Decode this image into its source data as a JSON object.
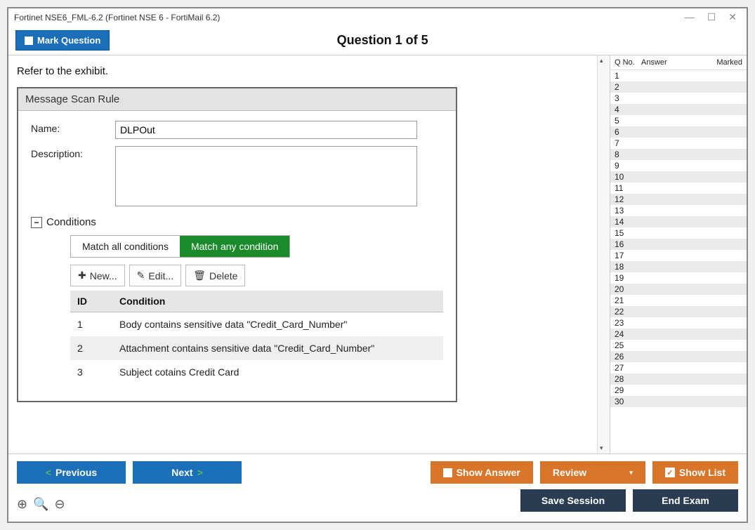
{
  "window": {
    "title": "Fortinet NSE6_FML-6.2 (Fortinet NSE 6 - FortiMail 6.2)"
  },
  "toolbar": {
    "mark_question": "Mark Question"
  },
  "question": {
    "title": "Question 1 of 5",
    "prompt": "Refer to the exhibit."
  },
  "exhibit": {
    "header": "Message Scan Rule",
    "name_label": "Name:",
    "name_value": "DLPOut",
    "description_label": "Description:",
    "description_value": "",
    "conditions_label": "Conditions",
    "match_all": "Match all conditions",
    "match_any": "Match any condition",
    "new_btn": "New...",
    "edit_btn": "Edit...",
    "delete_btn": "Delete",
    "col_id": "ID",
    "col_condition": "Condition",
    "rows": [
      {
        "id": "1",
        "text": "Body contains sensitive data \"Credit_Card_Number\""
      },
      {
        "id": "2",
        "text": "Attachment contains sensitive data \"Credit_Card_Number\""
      },
      {
        "id": "3",
        "text": "Subject cotains Credit Card"
      }
    ]
  },
  "side": {
    "col_qno": "Q No.",
    "col_answer": "Answer",
    "col_marked": "Marked",
    "count": 30
  },
  "buttons": {
    "previous": "Previous",
    "next": "Next",
    "show_answer": "Show Answer",
    "review": "Review",
    "show_list": "Show List",
    "save_session": "Save Session",
    "end_exam": "End Exam"
  }
}
